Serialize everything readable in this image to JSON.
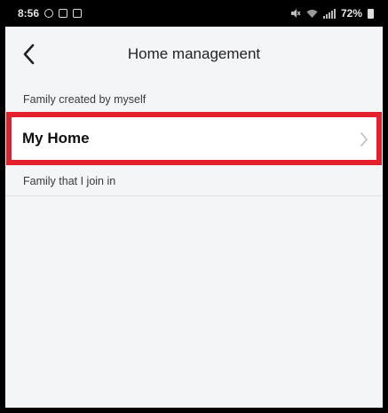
{
  "status_bar": {
    "time": "8:56",
    "battery_text": "72%",
    "left_icons": [
      "notification-icon",
      "image-icon",
      "calendar-icon"
    ],
    "right_icons": [
      "mute-icon",
      "wifi-icon",
      "signal-icon",
      "battery-icon"
    ]
  },
  "header": {
    "title": "Home management",
    "back_icon": "chevron-left-icon"
  },
  "sections": {
    "created": {
      "label": "Family created by myself",
      "items": [
        {
          "label": "My Home",
          "icon": "chevron-right-icon",
          "highlighted": true
        }
      ]
    },
    "joined": {
      "label": "Family that I join in"
    }
  },
  "colors": {
    "highlight": "#e3202b",
    "background": "#f4f5f7",
    "row": "#ffffff",
    "status_bar": "#000000"
  }
}
